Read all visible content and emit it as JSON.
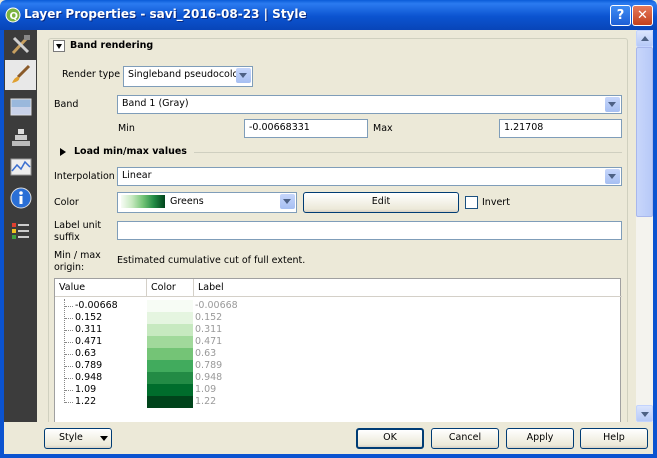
{
  "window": {
    "title": "Layer Properties - savi_2016-08-23 | Style",
    "help_glyph": "?",
    "close_glyph": "✕"
  },
  "sidebar": {
    "items": [
      {
        "name": "general",
        "icon": "tools-icon"
      },
      {
        "name": "style",
        "icon": "paintbrush-icon",
        "active": true
      },
      {
        "name": "transparency",
        "icon": "transparency-icon"
      },
      {
        "name": "pyramids",
        "icon": "pyramids-icon"
      },
      {
        "name": "histogram",
        "icon": "histogram-icon"
      },
      {
        "name": "metadata",
        "icon": "info-icon"
      },
      {
        "name": "legend",
        "icon": "legend-icon"
      }
    ]
  },
  "band_rendering": {
    "header": "Band rendering",
    "render_type_label": "Render type",
    "render_type_value": "Singleband pseudocolor",
    "band_label": "Band",
    "band_value": "Band 1 (Gray)",
    "min_label": "Min",
    "min_value": "-0.00668331",
    "max_label": "Max",
    "max_value": "1.21708",
    "load_minmax": "Load min/max values",
    "interpolation_label": "Interpolation",
    "interpolation_value": "Linear",
    "color_label": "Color",
    "color_ramp": "Greens",
    "edit_label": "Edit",
    "invert_label": "Invert",
    "invert_checked": false,
    "label_unit_line1": "Label unit",
    "label_unit_line2": "suffix",
    "label_unit_value": "",
    "origin_line1": "Min / max",
    "origin_line2": "origin:",
    "origin_value": "Estimated cumulative cut of full extent."
  },
  "color_table": {
    "headers": [
      "Value",
      "Color",
      "Label"
    ],
    "rows": [
      {
        "value": "-0.00668",
        "color": "#f7fcf5",
        "label": "-0.00668"
      },
      {
        "value": "0.152",
        "color": "#e5f5e0",
        "label": "0.152"
      },
      {
        "value": "0.311",
        "color": "#c7e9c0",
        "label": "0.311"
      },
      {
        "value": "0.471",
        "color": "#a1d99b",
        "label": "0.471"
      },
      {
        "value": "0.63",
        "color": "#74c476",
        "label": "0.63"
      },
      {
        "value": "0.789",
        "color": "#41ab5d",
        "label": "0.789"
      },
      {
        "value": "0.948",
        "color": "#238b45",
        "label": "0.948"
      },
      {
        "value": "1.09",
        "color": "#006d2c",
        "label": "1.09"
      },
      {
        "value": "1.22",
        "color": "#00441b",
        "label": "1.22"
      }
    ]
  },
  "footer": {
    "style_label": "Style",
    "ok_label": "OK",
    "cancel_label": "Cancel",
    "apply_label": "Apply",
    "help_label": "Help"
  }
}
